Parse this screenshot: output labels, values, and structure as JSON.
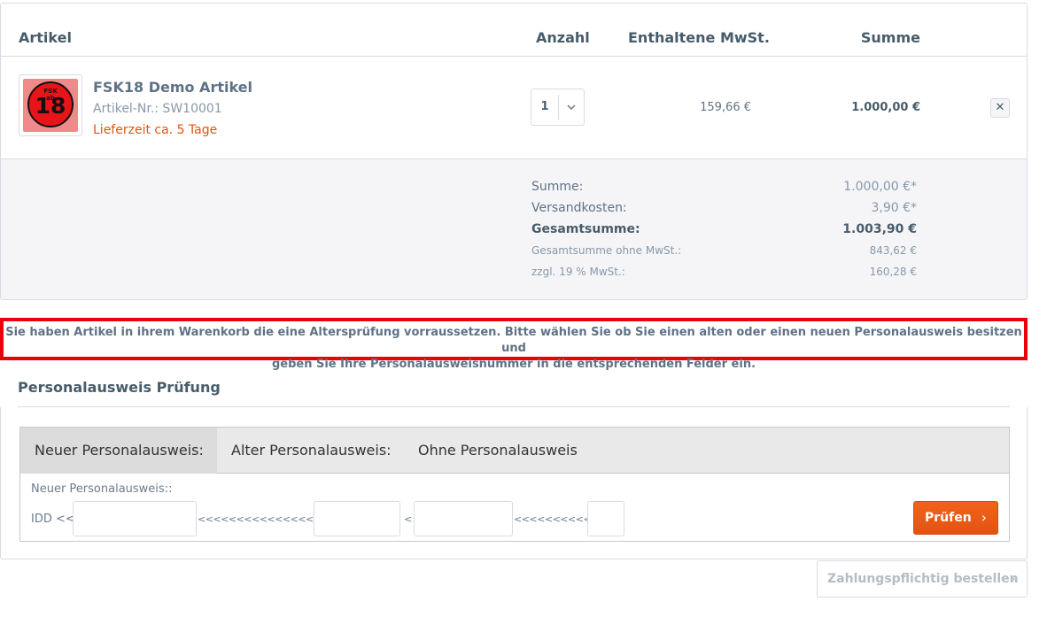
{
  "cart": {
    "headers": {
      "article": "Artikel",
      "quantity": "Anzahl",
      "tax": "Enthaltene MwSt.",
      "sum": "Summe"
    },
    "item": {
      "badge_small": "FSK\nab",
      "badge_number": "18",
      "name": "FSK18 Demo Artikel",
      "sku": "Artikel-Nr.: SW10001",
      "delivery": "Lieferzeit ca. 5 Tage",
      "quantity": "1",
      "tax": "159,66 €",
      "total": "1.000,00 €",
      "remove": "✕"
    },
    "totals": [
      {
        "label": "Summe:",
        "value": "1.000,00 €*"
      },
      {
        "label": "Versandkosten:",
        "value": "3,90 €*"
      },
      {
        "label": "Gesamtsumme:",
        "value": "1.003,90 €"
      },
      {
        "label": "Gesamtsumme ohne MwSt.:",
        "value": "843,62 €"
      },
      {
        "label": "zzgl. 19 % MwSt.:",
        "value": "160,28 €"
      }
    ]
  },
  "age_warning": {
    "line1": "Sie haben Artikel in ihrem Warenkorb die eine Altersprüfung vorraussetzen. Bitte wählen Sie ob Sie einen alten oder einen neuen Personalausweis besitzen und",
    "line2": "geben Sie Ihre Personalausweisnummer in die entsprechenden Felder ein."
  },
  "id_check": {
    "title": "Personalausweis Prüfung",
    "tabs": [
      "Neuer Personalausweis:",
      "Alter Personalausweis:",
      "Ohne Personalausweis"
    ],
    "active_tab": 0,
    "field_title": "Neuer Personalausweis::",
    "prefix": "IDD <<",
    "sep1": "<<<<<<<<<<<<<<<<<",
    "sep2": "<",
    "sep3": "<<<<<<<<<<",
    "inputs": [
      "",
      "",
      "",
      ""
    ],
    "check_label": "Prüfen",
    "arrow": "›"
  },
  "order": {
    "label": "Zahlungspflichtig bestellen",
    "arrow": "›"
  },
  "colors": {
    "accent": "#e1540f",
    "warning_border": "#e8000b",
    "text": "#5f7285"
  }
}
